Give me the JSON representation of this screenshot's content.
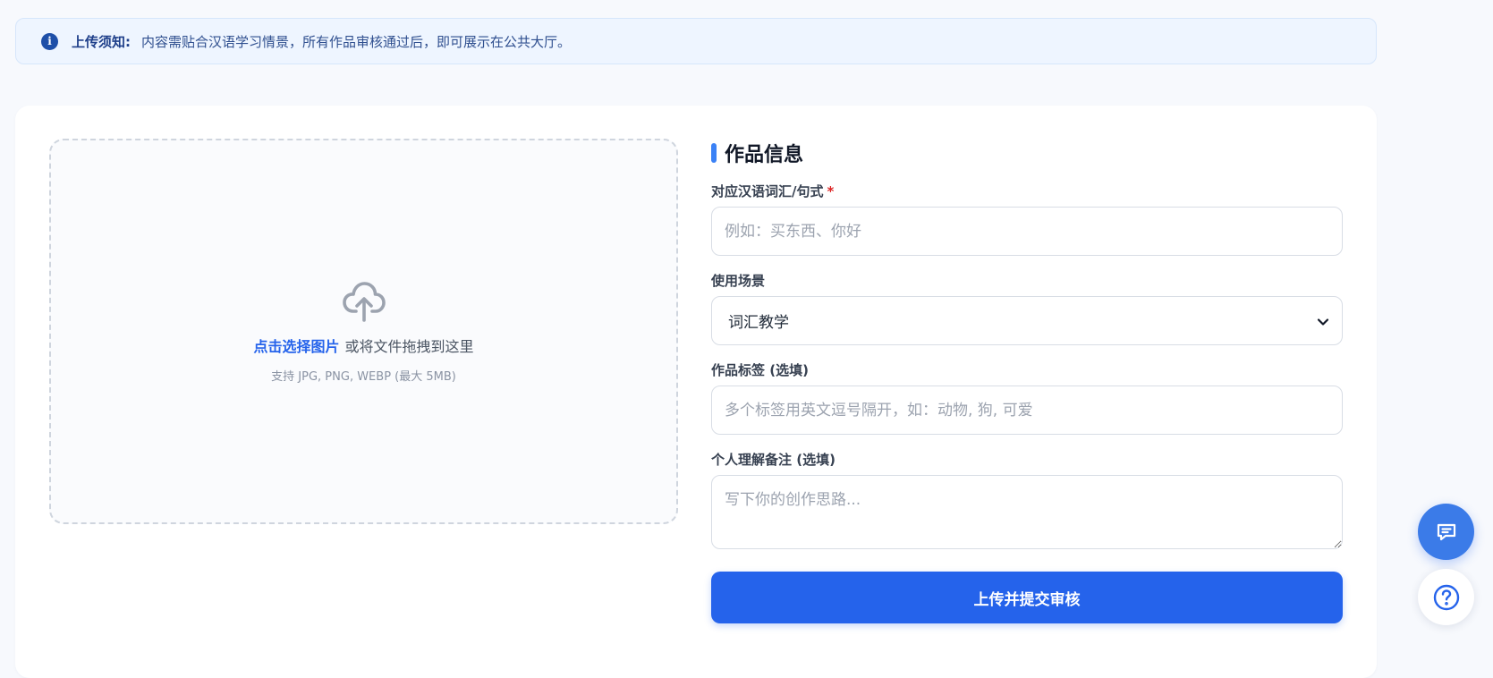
{
  "notice": {
    "title": "上传须知:",
    "text": "内容需贴合汉语学习情景，所有作品审核通过后，即可展示在公共大厅。"
  },
  "upload": {
    "link_label": "点击选择图片",
    "drag_text": "或将文件拖拽到这里",
    "hint": "支持 JPG, PNG, WEBP (最大 5MB)"
  },
  "form": {
    "section_title": "作品信息",
    "vocab": {
      "label": "对应汉语词汇/句式",
      "required_mark": "*",
      "placeholder": "例如：买东西、你好"
    },
    "scene": {
      "label": "使用场景",
      "selected": "词汇教学"
    },
    "tags": {
      "label": "作品标签 (选填)",
      "placeholder": "多个标签用英文逗号隔开，如：动物, 狗, 可爱"
    },
    "note": {
      "label": "个人理解备注 (选填)",
      "placeholder": "写下你的创作思路..."
    },
    "submit_label": "上传并提交审核"
  },
  "icons": {
    "info": "info-icon",
    "upload": "cloud-upload-icon",
    "chevron": "chevron-down-icon",
    "chat": "chat-icon",
    "help": "help-icon"
  },
  "colors": {
    "accent": "#2563eb",
    "notice_bg": "#eef5ff",
    "required": "#dc2626"
  }
}
